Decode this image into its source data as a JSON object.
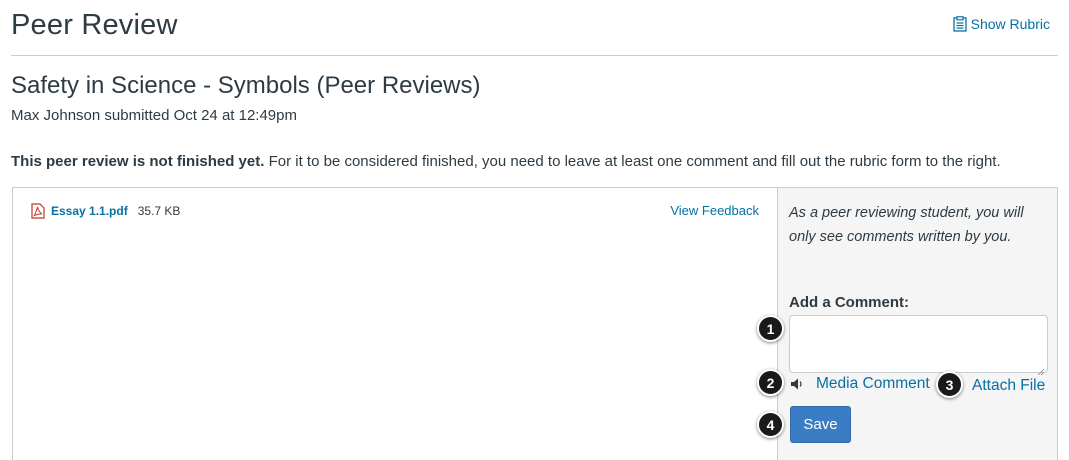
{
  "header": {
    "title": "Peer Review",
    "show_rubric_label": "Show Rubric"
  },
  "assignment": {
    "title": "Safety in Science - Symbols (Peer Reviews)",
    "submitted_line": "Max Johnson submitted Oct 24 at 12:49pm"
  },
  "notice": {
    "bold": "This peer review is not finished yet.",
    "rest": " For it to be considered finished, you need to leave at least one comment and fill out the rubric form to the right."
  },
  "file": {
    "name": "Essay 1.1.pdf",
    "size": "35.7 KB",
    "view_feedback_label": "View Feedback",
    "icon": "pdf-icon"
  },
  "comments": {
    "peer_note": "As a peer reviewing student, you will only see comments written by you.",
    "add_label": "Add a Comment:",
    "comment_value": "",
    "media_comment_label": "Media Comment",
    "attach_file_label": "Attach File",
    "save_label": "Save"
  },
  "markers": [
    "1",
    "2",
    "3",
    "4"
  ],
  "colors": {
    "link": "#0770a3",
    "button": "#3a7dc4",
    "panel_bg": "#f5f5f5",
    "border": "#c7cdd1",
    "text": "#2d3b45"
  }
}
